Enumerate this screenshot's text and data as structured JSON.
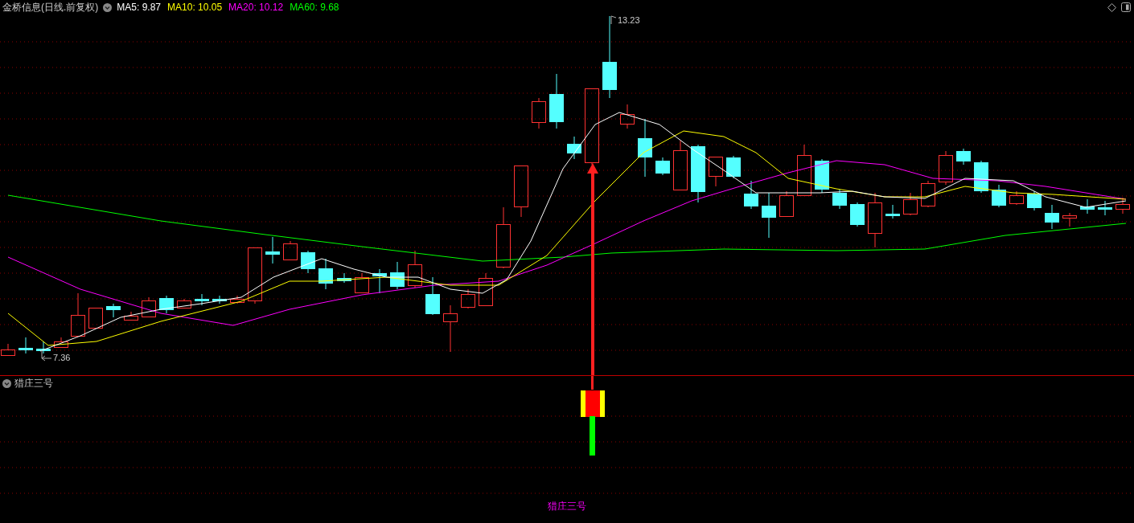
{
  "header": {
    "title": "金桥信息(日线.前复权)",
    "ma_values": [
      {
        "label": "MA5:",
        "value": "9.87",
        "color": "#ffffff"
      },
      {
        "label": "MA10:",
        "value": "10.05",
        "color": "#ffff00"
      },
      {
        "label": "MA20:",
        "value": "10.12",
        "color": "#ff00ff"
      },
      {
        "label": "MA60:",
        "value": "9.68",
        "color": "#00ff00"
      }
    ]
  },
  "price_chart": {
    "high_label": "13.23",
    "low_label": "7.36"
  },
  "indicator_panel": {
    "title": "猎庄三号",
    "caption": "猎庄三号"
  }
}
